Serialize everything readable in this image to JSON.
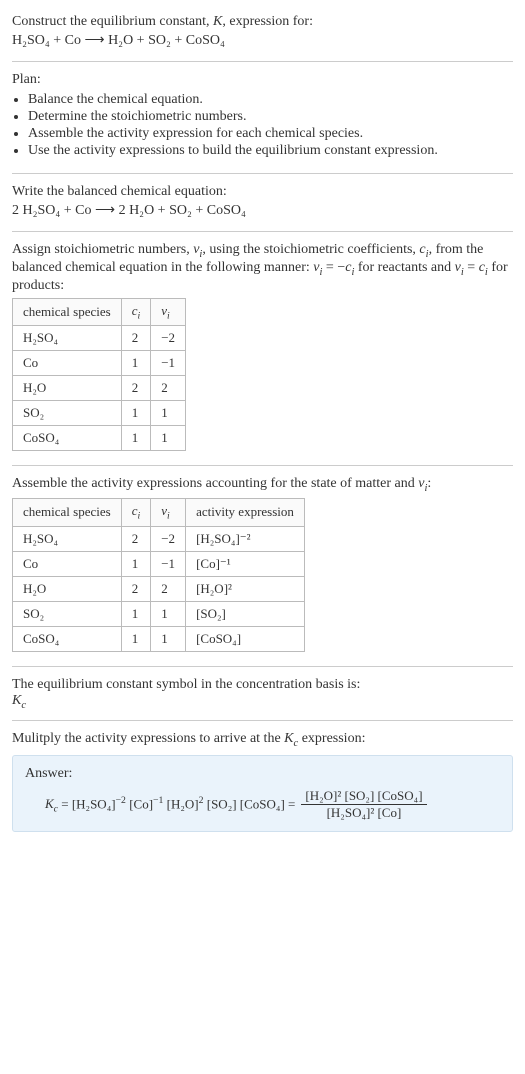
{
  "title_line": "Construct the equilibrium constant, K, expression for:",
  "unbalanced_eq": "H₂SO₄ + Co ⟶ H₂O + SO₂ + CoSO₄",
  "plan_label": "Plan:",
  "plan_items": [
    "Balance the chemical equation.",
    "Determine the stoichiometric numbers.",
    "Assemble the activity expression for each chemical species.",
    "Use the activity expressions to build the equilibrium constant expression."
  ],
  "balanced_label": "Write the balanced chemical equation:",
  "balanced_eq": "2 H₂SO₄ + Co ⟶ 2 H₂O + SO₂ + CoSO₄",
  "assign_text": "Assign stoichiometric numbers, νᵢ, using the stoichiometric coefficients, cᵢ, from the balanced chemical equation in the following manner: νᵢ = −cᵢ for reactants and νᵢ = cᵢ for products:",
  "table1": {
    "headers": [
      "chemical species",
      "cᵢ",
      "νᵢ"
    ],
    "rows": [
      [
        "H₂SO₄",
        "2",
        "−2"
      ],
      [
        "Co",
        "1",
        "−1"
      ],
      [
        "H₂O",
        "2",
        "2"
      ],
      [
        "SO₂",
        "1",
        "1"
      ],
      [
        "CoSO₄",
        "1",
        "1"
      ]
    ]
  },
  "assemble_text": "Assemble the activity expressions accounting for the state of matter and νᵢ:",
  "table2": {
    "headers": [
      "chemical species",
      "cᵢ",
      "νᵢ",
      "activity expression"
    ],
    "rows": [
      [
        "H₂SO₄",
        "2",
        "−2",
        "[H₂SO₄]⁻²"
      ],
      [
        "Co",
        "1",
        "−1",
        "[Co]⁻¹"
      ],
      [
        "H₂O",
        "2",
        "2",
        "[H₂O]²"
      ],
      [
        "SO₂",
        "1",
        "1",
        "[SO₂]"
      ],
      [
        "CoSO₄",
        "1",
        "1",
        "[CoSO₄]"
      ]
    ]
  },
  "kc_symbol_text": "The equilibrium constant symbol in the concentration basis is:",
  "kc_symbol": "K_c",
  "multiply_text": "Mulitply the activity expressions to arrive at the K_c expression:",
  "answer_label": "Answer:",
  "kc_lhs": "K_c = [H₂SO₄]⁻² [Co]⁻¹ [H₂O]² [SO₂] [CoSO₄] =",
  "kc_frac_num": "[H₂O]² [SO₂] [CoSO₄]",
  "kc_frac_den": "[H₂SO₄]² [Co]",
  "chart_data": {
    "type": "table",
    "title": "Stoichiometric numbers and activity expressions",
    "tables": [
      {
        "columns": [
          "chemical species",
          "c_i",
          "nu_i"
        ],
        "rows": [
          {
            "chemical species": "H2SO4",
            "c_i": 2,
            "nu_i": -2
          },
          {
            "chemical species": "Co",
            "c_i": 1,
            "nu_i": -1
          },
          {
            "chemical species": "H2O",
            "c_i": 2,
            "nu_i": 2
          },
          {
            "chemical species": "SO2",
            "c_i": 1,
            "nu_i": 1
          },
          {
            "chemical species": "CoSO4",
            "c_i": 1,
            "nu_i": 1
          }
        ]
      },
      {
        "columns": [
          "chemical species",
          "c_i",
          "nu_i",
          "activity expression"
        ],
        "rows": [
          {
            "chemical species": "H2SO4",
            "c_i": 2,
            "nu_i": -2,
            "activity expression": "[H2SO4]^-2"
          },
          {
            "chemical species": "Co",
            "c_i": 1,
            "nu_i": -1,
            "activity expression": "[Co]^-1"
          },
          {
            "chemical species": "H2O",
            "c_i": 2,
            "nu_i": 2,
            "activity expression": "[H2O]^2"
          },
          {
            "chemical species": "SO2",
            "c_i": 1,
            "nu_i": 1,
            "activity expression": "[SO2]"
          },
          {
            "chemical species": "CoSO4",
            "c_i": 1,
            "nu_i": 1,
            "activity expression": "[CoSO4]"
          }
        ]
      }
    ],
    "equilibrium_expression": "K_c = ([H2O]^2 [SO2] [CoSO4]) / ([H2SO4]^2 [Co])"
  }
}
